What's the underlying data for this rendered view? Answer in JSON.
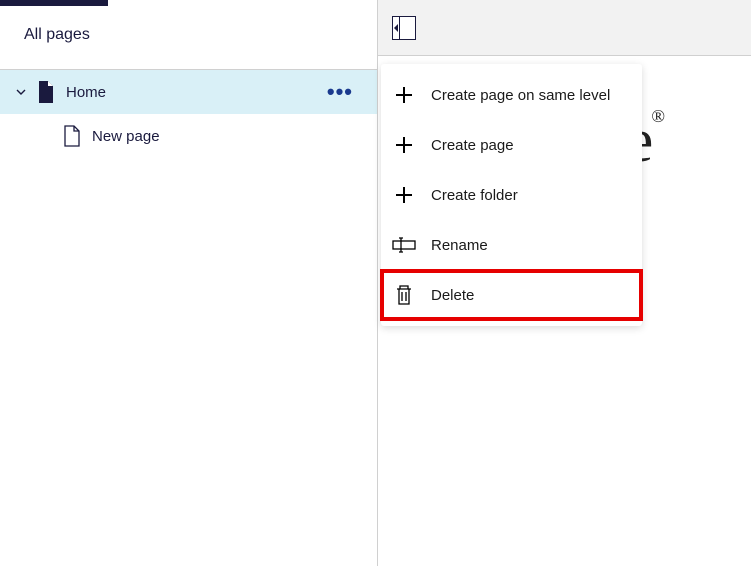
{
  "sidebar": {
    "header": "All pages",
    "tree": {
      "home_label": "Home",
      "child_label": "New page"
    }
  },
  "context_menu": {
    "items": {
      "create_same_level": "Create page on same level",
      "create_page": "Create page",
      "create_folder": "Create folder",
      "rename": "Rename",
      "delete": "Delete"
    }
  },
  "main": {
    "background_glyph": "e"
  }
}
